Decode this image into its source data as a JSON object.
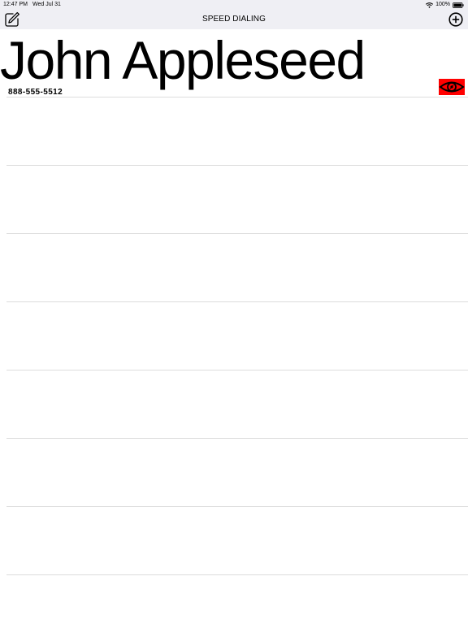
{
  "status_bar": {
    "time": "12:47 PM",
    "date": "Wed Jul 31",
    "battery": "100%",
    "icons": [
      "wifi-icon",
      "battery-icon"
    ]
  },
  "nav": {
    "title": "SPEED DIALING",
    "left_icon": "edit-icon",
    "right_icon": "add-circle-icon"
  },
  "contacts": [
    {
      "name": "John Appleseed",
      "phone": "888-555-5512",
      "action_icon": "eye-icon",
      "action_color": "#ff0000"
    }
  ]
}
